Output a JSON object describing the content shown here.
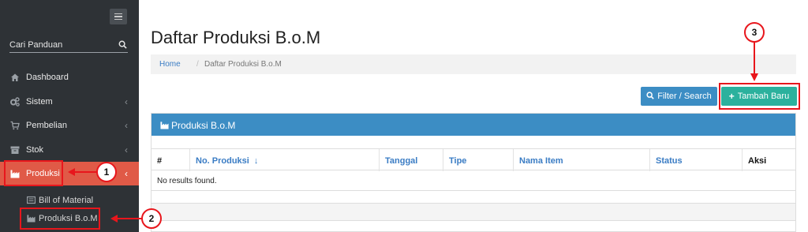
{
  "sidebar": {
    "menu_icon": "hamburger-icon",
    "search": {
      "placeholder": "Cari Panduan",
      "icon": "search-icon"
    },
    "items": [
      {
        "label": "Dashboard",
        "icon": "home-icon",
        "chevron": false
      },
      {
        "label": "Sistem",
        "icon": "cogs-icon",
        "chevron": true
      },
      {
        "label": "Pembelian",
        "icon": "cart-icon",
        "chevron": true
      },
      {
        "label": "Stok",
        "icon": "archive-icon",
        "chevron": true
      },
      {
        "label": "Produksi",
        "icon": "industry-icon",
        "chevron": true,
        "active": true
      }
    ],
    "sub_items": [
      {
        "label": "Bill of Material",
        "icon": "list-icon"
      },
      {
        "label": "Produksi B.o.M",
        "icon": "industry-icon"
      }
    ]
  },
  "main": {
    "title": "Daftar Produksi B.o.M",
    "breadcrumb": {
      "home": "Home",
      "separator": "/",
      "current": "Daftar Produksi B.o.M"
    },
    "buttons": {
      "filter": "Filter / Search",
      "add": "Tambah Baru"
    },
    "panel": {
      "title": "Produksi B.o.M",
      "columns": [
        "#",
        "No. Produksi",
        "Tanggal",
        "Tipe",
        "Nama Item",
        "Status",
        "Aksi"
      ],
      "empty_text": "No results found."
    }
  },
  "annotations": [
    "1",
    "2",
    "3"
  ],
  "colors": {
    "sidebar_bg": "#2e3236",
    "active_item": "#e05a47",
    "primary": "#3c8dc4",
    "success": "#2bb19d",
    "annotation": "#e8161c"
  }
}
